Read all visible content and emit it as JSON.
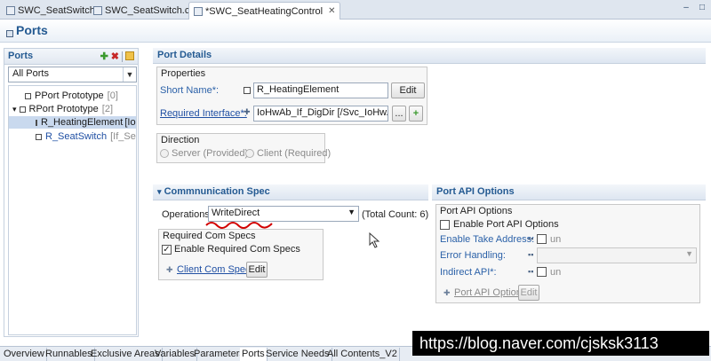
{
  "editor_tabs": [
    {
      "label": "SWC_SeatSwitch"
    },
    {
      "label": "SWC_SeatSwitch.c"
    },
    {
      "label": "*SWC_SeatHeatingControl"
    }
  ],
  "header": {
    "title": "Ports"
  },
  "left": {
    "title": "Ports",
    "filter_value": "All Ports",
    "tree": {
      "pport_label": "PPort Prototype",
      "pport_count": "[0]",
      "rport_label": "RPort Prototype",
      "rport_count": "[2]",
      "item1_label": "R_HeatingElement",
      "item1_iface": "[IoHw",
      "item2_label": "R_SeatSwitch",
      "item2_iface": "[If_SeatSw"
    }
  },
  "port_details": {
    "title": "Port Details",
    "properties_title": "Properties",
    "short_name_label": "Short Name*:",
    "short_name_value": "R_HeatingElement",
    "edit_label": "Edit",
    "required_interface_label": "Required Interface*:",
    "required_interface_value": "IoHwAb_If_DigDir [/Svc_IoHwAb/",
    "browse_label": "...",
    "direction_title": "Direction",
    "server_label": "Server (Provided)",
    "client_label": "Client (Required)"
  },
  "comm_spec": {
    "title": "Commnunication Spec",
    "operations_label": "Operations",
    "operations_value": "WriteDirect",
    "total_count": "(Total Count: 6)",
    "required_group_title": "Required Com Specs",
    "enable_label": "Enable Required Com Specs",
    "client_spec_link": "Client Com Spec",
    "edit_label": "Edit"
  },
  "port_api": {
    "title": "Port API Options",
    "group_title": "Port API Options",
    "enable_label": "Enable Port API Options",
    "take_address_label": "Enable Take Address:",
    "take_address_value": "un",
    "error_handling_label": "Error Handling:",
    "indirect_api_label": "Indirect API*:",
    "indirect_api_value": "un",
    "port_api_option_link": "Port API Option",
    "edit_label": "Edit"
  },
  "bottom_tabs": [
    {
      "label": "Overview"
    },
    {
      "label": "Runnables"
    },
    {
      "label": "Exclusive Areas"
    },
    {
      "label": "Variables"
    },
    {
      "label": "Parameters"
    },
    {
      "label": "Ports"
    },
    {
      "label": "Service Needs"
    },
    {
      "label": "All Contents_V2"
    }
  ],
  "watermark": "https://blog.naver.com/cjsksk3113",
  "colors": {
    "accent": "#245a92",
    "link": "#1f4fa3",
    "annotation": "#d10000"
  }
}
